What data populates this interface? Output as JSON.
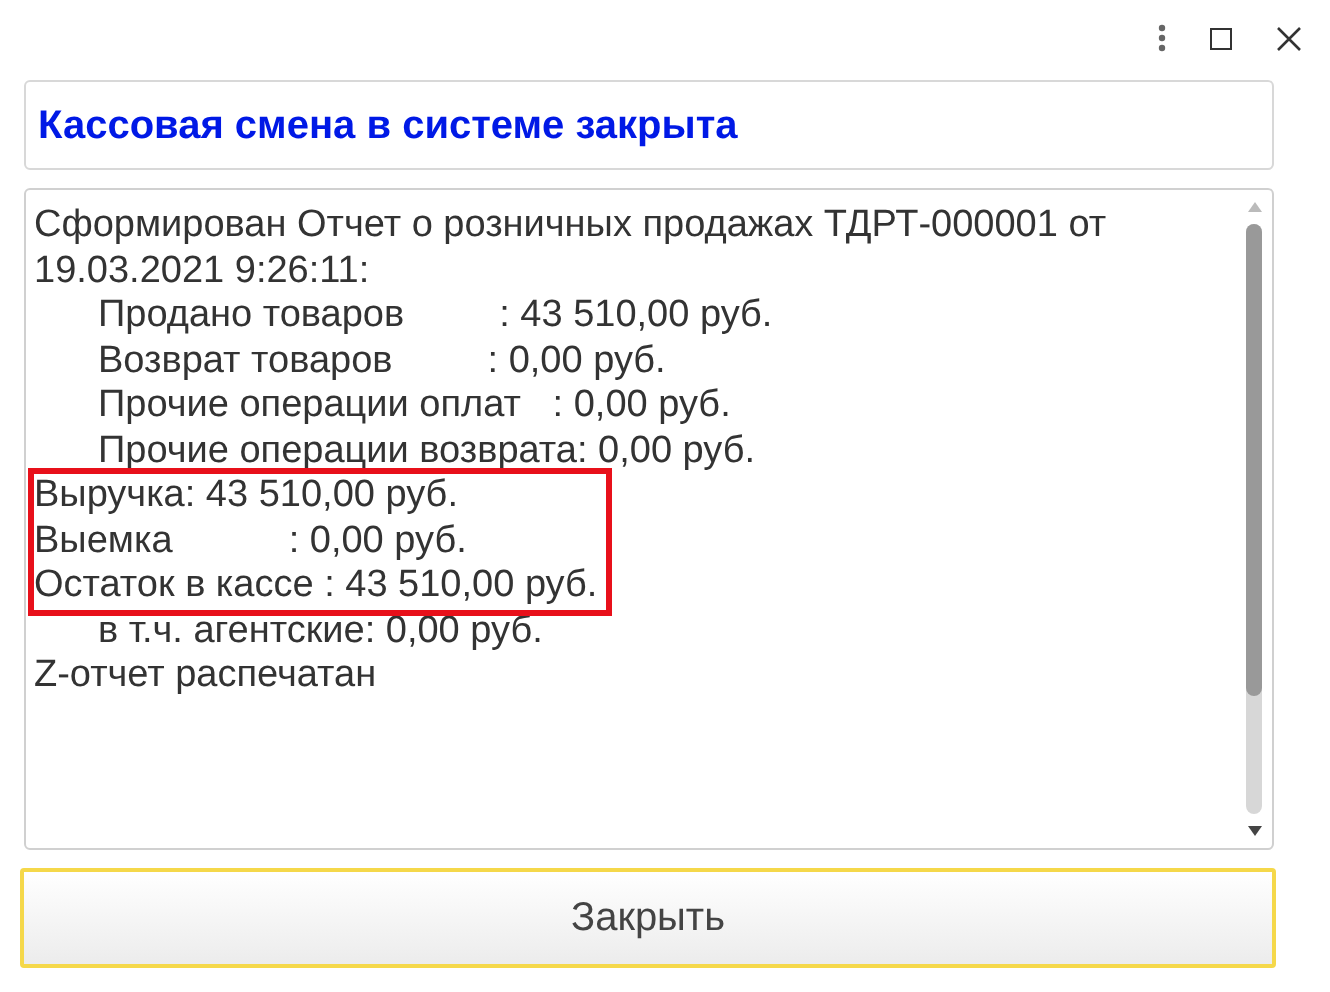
{
  "header": {
    "title": "Кассовая смена в системе закрыта"
  },
  "report": {
    "lines": [
      {
        "text": "Сформирован Отчет о розничных продажах ТДРТ-000001 от 19.03.2021 9:26:11:",
        "highlighted": false,
        "children": [
          {
            "text": "Продано товаров         : 43 510,00 руб.",
            "highlighted": false
          },
          {
            "text": "Возврат товаров         : 0,00 руб.",
            "highlighted": false
          },
          {
            "text": "Прочие операции оплат   : 0,00 руб.",
            "highlighted": false
          },
          {
            "text": "Прочие операции возврата: 0,00 руб.",
            "highlighted": false
          }
        ]
      },
      {
        "text": "Выручка: 43 510,00 руб.",
        "highlighted": true
      },
      {
        "text": "Выемка           : 0,00 руб.",
        "highlighted": true
      },
      {
        "text": "Остаток в кассе : 43 510,00 руб.",
        "highlighted": true,
        "children": [
          {
            "text": "в т.ч. агентские: 0,00 руб.",
            "highlighted": false
          }
        ]
      },
      {
        "text": "Z-отчет распечатан",
        "highlighted": false
      }
    ]
  },
  "buttons": [
    {
      "label": "Закрыть",
      "selected": true
    }
  ]
}
